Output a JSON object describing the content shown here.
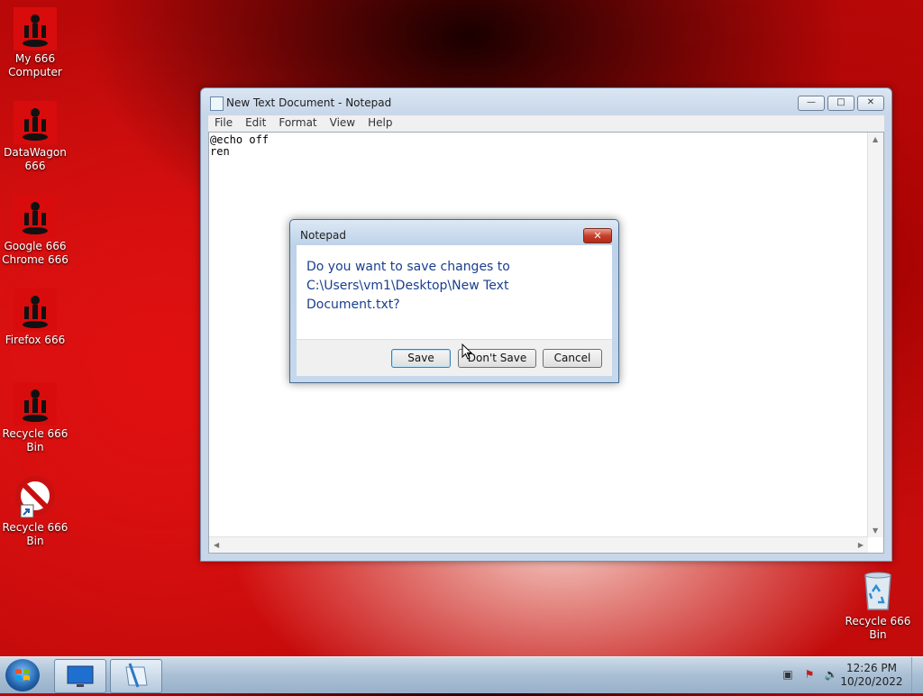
{
  "desktop_icons": [
    {
      "label": "My 666 Computer",
      "icon": "666-icon"
    },
    {
      "label": "DataWagon 666",
      "icon": "666-icon"
    },
    {
      "label": "Google 666 Chrome 666",
      "icon": "666-icon"
    },
    {
      "label": "Firefox 666",
      "icon": "666-icon"
    },
    {
      "label": "Recycle 666 Bin",
      "icon": "666-icon"
    },
    {
      "label": "Recycle 666 Bin",
      "icon": "no-symbol-shortcut-icon"
    },
    {
      "label": "Recycle 666 Bin",
      "icon": "recycle-bin-icon"
    }
  ],
  "notepad": {
    "title": "New Text Document - Notepad",
    "menu": [
      "File",
      "Edit",
      "Format",
      "View",
      "Help"
    ],
    "content": "@echo off\nren"
  },
  "dialog": {
    "title": "Notepad",
    "message": "Do you want to save changes to C:\\Users\\vm1\\Desktop\\New Text Document.txt?",
    "buttons": {
      "save": "Save",
      "dont_save": "Don't Save",
      "cancel": "Cancel"
    }
  },
  "taskbar": {
    "time": "12:26 PM",
    "date": "10/20/2022"
  },
  "colors": {
    "accent_red": "#d80c0c",
    "dialog_text": "#1a3f8f"
  }
}
